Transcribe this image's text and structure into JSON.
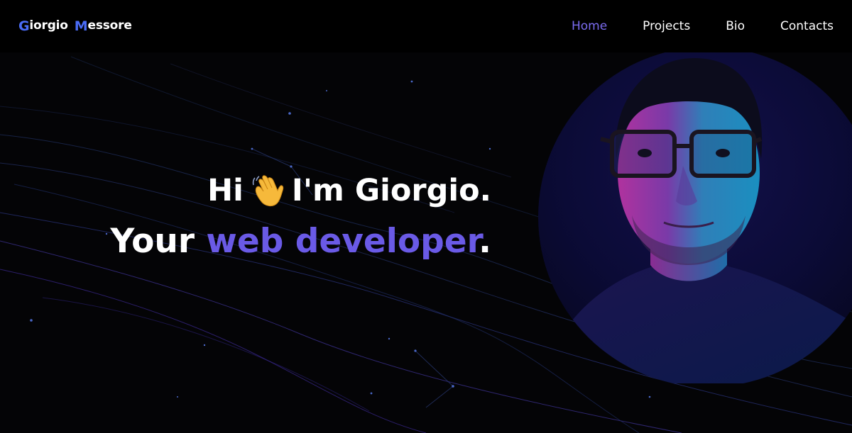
{
  "brand": {
    "first_initial": "G",
    "first_rest": "iorgio",
    "last_initial": "M",
    "last_rest": "essore"
  },
  "nav": {
    "items": [
      {
        "label": "Home",
        "active": true
      },
      {
        "label": "Projects",
        "active": false
      },
      {
        "label": "Bio",
        "active": false
      },
      {
        "label": "Contacts",
        "active": false
      }
    ]
  },
  "hero": {
    "greeting": "Hi",
    "greeting_icon": "waving-hand-icon",
    "intro": "I'm Giorgio.",
    "prefix": "Your",
    "role": "web developer",
    "suffix": "."
  },
  "colors": {
    "accent": "#6a5ae6",
    "nav_active": "#7b6cf0",
    "logo_initial": "#4a6cf7",
    "background": "#040406"
  }
}
